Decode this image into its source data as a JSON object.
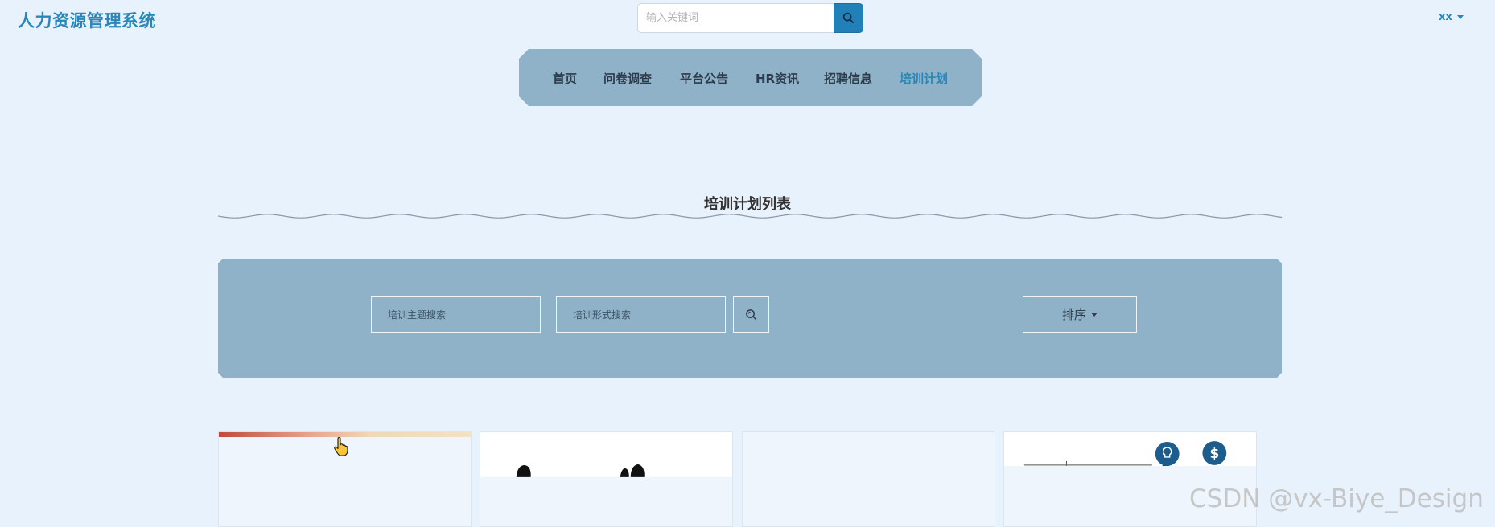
{
  "header": {
    "logo": "人力资源管理系统",
    "search_placeholder": "输入关键词",
    "user_name": "xx"
  },
  "nav": {
    "items": [
      {
        "label": "首页"
      },
      {
        "label": "问卷调查"
      },
      {
        "label": "平台公告"
      },
      {
        "label": "HR资讯"
      },
      {
        "label": "招聘信息"
      },
      {
        "label": "培训计划",
        "active": true
      }
    ]
  },
  "section": {
    "title": "培训计划列表"
  },
  "filters": {
    "topic_placeholder": "培训主题搜索",
    "format_placeholder": "培训形式搜索",
    "sort_label": "排序"
  },
  "watermark": "CSDN @vx-Biye_Design",
  "colors": {
    "background": "#e8f2fc",
    "accent": "#2a86b8",
    "panel": "#8fb2c9",
    "search_button": "#2280b9"
  },
  "icons": {
    "search": "magnifier-icon",
    "cursor": "hand-pointer-icon"
  }
}
